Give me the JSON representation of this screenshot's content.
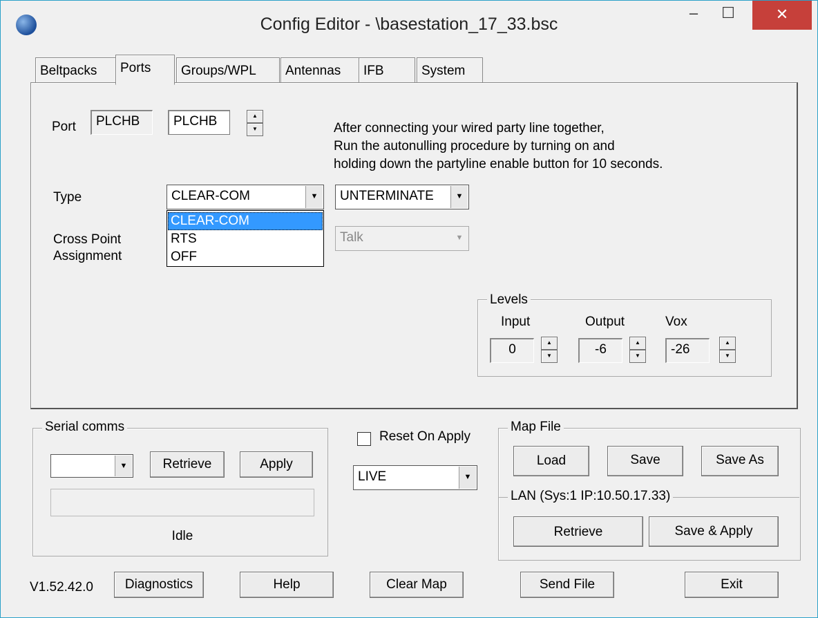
{
  "window": {
    "title": "Config Editor - \\basestation_17_33.bsc",
    "minimize_symbol": "–",
    "maximize_symbol": "☐",
    "close_symbol": "✕"
  },
  "tabs": [
    "Beltpacks",
    "Ports",
    "Groups/WPL",
    "Antennas",
    "IFB",
    "System"
  ],
  "active_tab": "Ports",
  "ports": {
    "port_label": "Port",
    "port_name_display": "PLCHB",
    "port_name_value": "PLCHB",
    "instructions": [
      "After connecting your wired party line together,",
      "Run the autonulling procedure by turning on and",
      "holding down the partyline enable button for 10 seconds."
    ],
    "type_label": "Type",
    "type_value": "CLEAR-COM",
    "type_options": [
      "CLEAR-COM",
      "RTS",
      "OFF"
    ],
    "type_options_selected": "CLEAR-COM",
    "termination_value": "UNTERMINATE",
    "crosspoint_label_line1": "Cross Point",
    "crosspoint_label_line2": "Assignment",
    "crosspoint_mode": "Talk",
    "levels": {
      "group_label": "Levels",
      "input_label": "Input",
      "input_value": "0",
      "output_label": "Output",
      "output_value": "-6",
      "vox_label": "Vox",
      "vox_value": "-26"
    }
  },
  "serial_comms": {
    "group_label": "Serial comms",
    "port_value": "",
    "retrieve_label": "Retrieve",
    "apply_label": "Apply",
    "status": "Idle"
  },
  "reset_on_apply": {
    "label": "Reset On Apply",
    "checked": false
  },
  "mode_select": {
    "value": "LIVE"
  },
  "map_file": {
    "group_label": "Map File",
    "load_label": "Load",
    "save_label": "Save",
    "save_as_label": "Save As"
  },
  "lan": {
    "group_label": "LAN  (Sys:1 IP:10.50.17.33)",
    "retrieve_label": "Retrieve",
    "save_apply_label": "Save & Apply"
  },
  "footer": {
    "version": "V1.52.42.0",
    "diagnostics_label": "Diagnostics",
    "help_label": "Help",
    "clear_map_label": "Clear Map",
    "send_file_label": "Send File",
    "exit_label": "Exit"
  },
  "colors": {
    "selection": "#3399ff",
    "close_button": "#c6403a",
    "window_border": "#2aa1c8"
  }
}
